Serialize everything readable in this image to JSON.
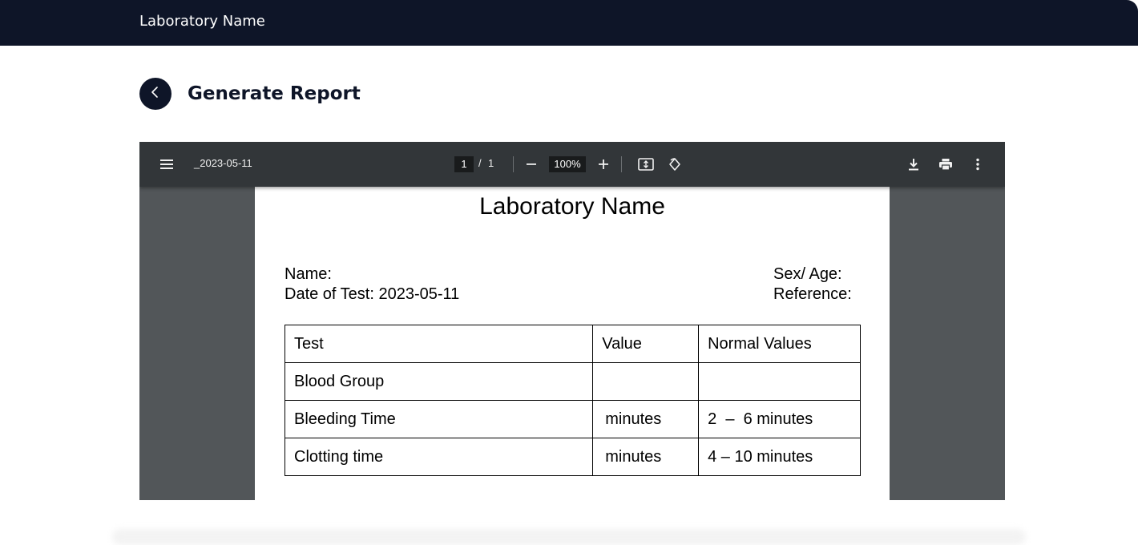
{
  "header": {
    "brand": "Laboratory Name"
  },
  "page": {
    "title": "Generate Report"
  },
  "viewer": {
    "doc_title": "_2023-05-11",
    "current_page": "1",
    "separator": "/",
    "total_pages": "1",
    "zoom": "100%"
  },
  "report": {
    "lab_name": "Laboratory Name",
    "name_label": "Name:",
    "date_line": "Date of Test: 2023-05-11",
    "sex_age_label": "Sex/ Age:",
    "reference_label": "Reference:",
    "columns": [
      "Test",
      "Value",
      "Normal Values"
    ],
    "rows": [
      {
        "test": "Blood Group",
        "value": "",
        "normal": ""
      },
      {
        "test": "Bleeding Time",
        "value": "minutes",
        "normal": "2  –  6 minutes"
      },
      {
        "test": "Clotting time",
        "value": "minutes",
        "normal": "4 – 10 minutes"
      }
    ]
  },
  "icons": {
    "back": "chevron-left-icon",
    "menu": "hamburger-menu-icon",
    "zoom_out": "minus-icon",
    "zoom_in": "plus-icon",
    "fit": "fit-to-page-icon",
    "rotate": "rotate-icon",
    "download": "download-icon",
    "print": "print-icon",
    "more": "more-vertical-icon"
  },
  "colors": {
    "navy": "#0e1528",
    "viewer_toolbar": "#323639",
    "viewer_bg": "#525659"
  }
}
